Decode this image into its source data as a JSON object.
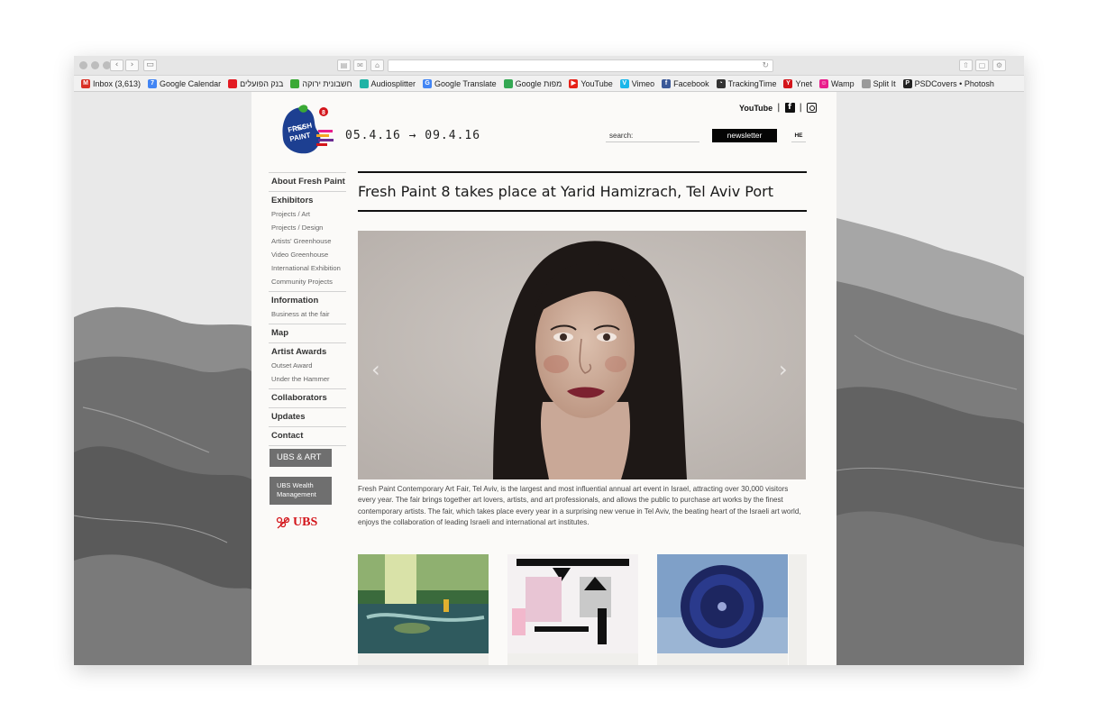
{
  "browser": {
    "bookmarks": [
      {
        "label": "Inbox (3,613)",
        "icon": "gmail-icon",
        "color": "#d93025",
        "glyph": "M"
      },
      {
        "label": "Google Calendar",
        "icon": "calendar-icon",
        "color": "#4285f4",
        "glyph": "7"
      },
      {
        "label": "בנק הפועלים",
        "icon": "bank-icon",
        "color": "#e31b23",
        "glyph": ""
      },
      {
        "label": "חשבונית ירוקה",
        "icon": "leaf-icon",
        "color": "#3aa935",
        "glyph": ""
      },
      {
        "label": "Audiosplitter",
        "icon": "audio-icon",
        "color": "#20b3a5",
        "glyph": ""
      },
      {
        "label": "Google Translate",
        "icon": "translate-icon",
        "color": "#4285f4",
        "glyph": "G"
      },
      {
        "label": "Google מפות",
        "icon": "maps-icon",
        "color": "#34a853",
        "glyph": ""
      },
      {
        "label": "YouTube",
        "icon": "youtube-icon",
        "color": "#e62117",
        "glyph": "▶"
      },
      {
        "label": "Vimeo",
        "icon": "vimeo-icon",
        "color": "#1ab7ea",
        "glyph": "V"
      },
      {
        "label": "Facebook",
        "icon": "facebook-icon",
        "color": "#3b5998",
        "glyph": "f"
      },
      {
        "label": "TrackingTime",
        "icon": "stopwatch-icon",
        "color": "#333333",
        "glyph": "◔"
      },
      {
        "label": "Ynet",
        "icon": "ynet-icon",
        "color": "#d3151b",
        "glyph": "Y"
      },
      {
        "label": "Wamp",
        "icon": "wamp-icon",
        "color": "#e91e8c",
        "glyph": "☺"
      },
      {
        "label": "Split It",
        "icon": "page-icon",
        "color": "#9a9a9a",
        "glyph": ""
      },
      {
        "label": "PSDCovers • Photosh",
        "icon": "psdcovers-icon",
        "color": "#222222",
        "glyph": "P"
      }
    ]
  },
  "site": {
    "dates": "05.4.16 → 09.4.16",
    "social": {
      "youtube": "YouTube"
    },
    "search_placeholder": "search:",
    "newsletter_label": "newsletter",
    "lang_label": "HE",
    "nav": [
      {
        "label": "About Fresh Paint",
        "sub": []
      },
      {
        "label": "Exhibitors",
        "sub": [
          "Projects / Art",
          "Projects / Design",
          "Artists' Greenhouse",
          "Video Greenhouse",
          "International Exhibition",
          "Community Projects"
        ]
      },
      {
        "label": "Information",
        "sub": [
          "Business at the fair"
        ]
      },
      {
        "label": "Map",
        "sub": []
      },
      {
        "label": "Artist Awards",
        "sub": [
          "Outset Award",
          "Under the Hammer"
        ]
      },
      {
        "label": "Collaborators",
        "sub": []
      },
      {
        "label": "Updates",
        "sub": []
      },
      {
        "label": "Contact",
        "sub": []
      }
    ],
    "ubs_art_label": "UBS & ART",
    "ubs_wealth_line1": "UBS Wealth",
    "ubs_wealth_line2": "Management",
    "ubs_logo": "UBS",
    "headline": "Fresh Paint 8 takes place at Yarid Hamizrach, Tel Aviv Port",
    "body": "Fresh Paint Contemporary Art Fair, Tel Aviv, is the largest and most influential annual art event in Israel, attracting over 30,000 visitors every year. The fair brings together art lovers, artists, and art professionals, and allows the public to purchase art works by the finest contemporary artists. The fair, which takes place every year in a surprising new venue in Tel Aviv, the beating heart of the Israeli art world, enjoys the collaboration of leading Israeli and international art institutes.",
    "slider_prev": "‹",
    "slider_next": "›"
  },
  "colors": {
    "accent_red": "#d3151b",
    "button_gray": "#6f6f6f",
    "page_bg": "#fbfaf8"
  }
}
